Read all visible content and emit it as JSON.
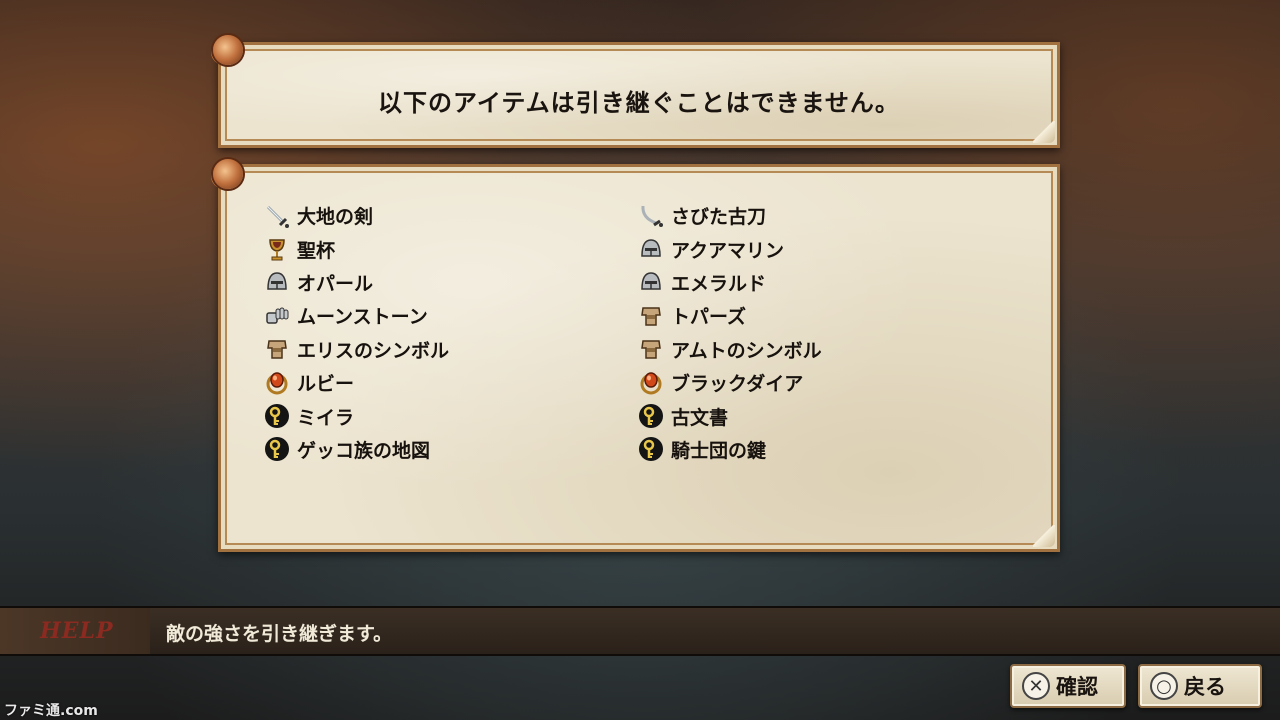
{
  "title": "以下のアイテムは引き継ぐことはできません。",
  "items_left": [
    {
      "icon": "sword-icon",
      "label": "大地の剣"
    },
    {
      "icon": "chalice-icon",
      "label": "聖杯"
    },
    {
      "icon": "helmet-icon",
      "label": "オパール"
    },
    {
      "icon": "gauntlet-icon",
      "label": "ムーンストーン"
    },
    {
      "icon": "armor-icon",
      "label": "エリスのシンボル"
    },
    {
      "icon": "ring-icon",
      "label": "ルビー"
    },
    {
      "icon": "key-icon",
      "label": "ミイラ"
    },
    {
      "icon": "key-icon",
      "label": "ゲッコ族の地図"
    }
  ],
  "items_right": [
    {
      "icon": "scimitar-icon",
      "label": "さびた古刀"
    },
    {
      "icon": "helmet-icon",
      "label": "アクアマリン"
    },
    {
      "icon": "helmet-icon",
      "label": "エメラルド"
    },
    {
      "icon": "armor-icon",
      "label": "トパーズ"
    },
    {
      "icon": "armor-icon",
      "label": "アムトのシンボル"
    },
    {
      "icon": "ring-icon",
      "label": "ブラックダイア"
    },
    {
      "icon": "key-icon",
      "label": "古文書"
    },
    {
      "icon": "key-icon",
      "label": "騎士団の鍵"
    }
  ],
  "help": {
    "label": "HELP",
    "text": "敵の強さを引き継ぎます。"
  },
  "buttons": {
    "confirm": {
      "glyph": "✕",
      "label": "確認"
    },
    "back": {
      "glyph": "○",
      "label": "戻る"
    }
  },
  "watermark": "ファミ通.com",
  "colors": {
    "parchment": "#ece4cf",
    "frame": "#a1723f",
    "help_label": "#8a2a20"
  }
}
